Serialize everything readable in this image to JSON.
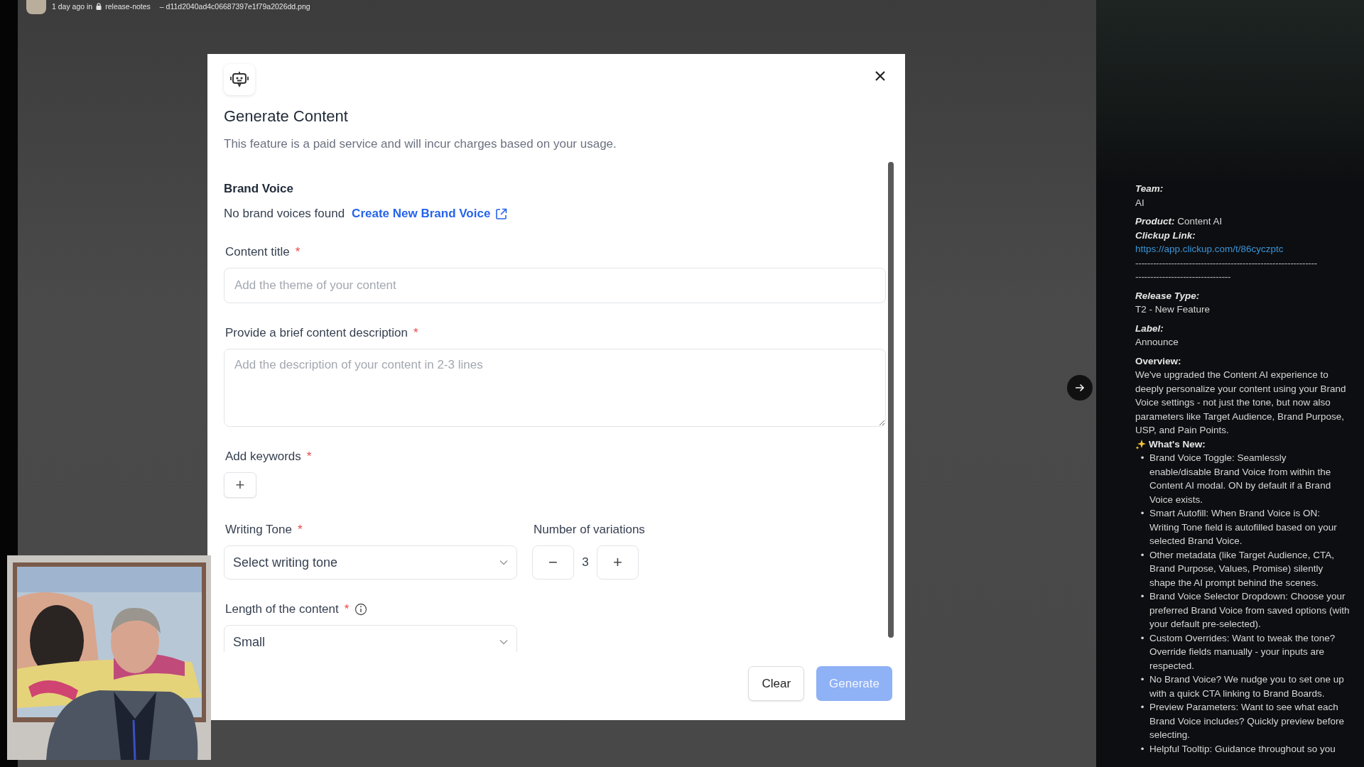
{
  "top_bar": {
    "time": "1 day ago in",
    "channel": "release-notes",
    "file": "– d11d2040ad4c06687397e1f79a2026dd.png"
  },
  "modal": {
    "title": "Generate Content",
    "subtitle": "This feature is a paid service and will incur charges based on your usage.",
    "brand_voice": {
      "heading": "Brand Voice",
      "empty_text": "No brand voices found",
      "link": "Create New Brand Voice"
    },
    "fields": [
      {
        "kind": "text",
        "label": "Content title",
        "required": "*",
        "placeholder": "Add the theme of your content"
      },
      {
        "kind": "textarea",
        "label": "Provide a brief content description",
        "required": "*",
        "placeholder": "Add the description of your content in 2-3 lines"
      },
      {
        "kind": "keywords",
        "label": "Add keywords",
        "required": "*",
        "add": "+"
      }
    ],
    "tone": {
      "label": "Writing Tone",
      "required": "*",
      "placeholder": "Select writing tone"
    },
    "variations": {
      "label": "Number of variations",
      "minus": "−",
      "value": "3",
      "plus": "+"
    },
    "length": {
      "label": "Length of the content",
      "required": "*",
      "info": true,
      "value": "Small"
    },
    "buttons": [
      {
        "label": "Clear",
        "kind": "secondary"
      },
      {
        "label": "Generate",
        "kind": "primary",
        "disabled": true
      }
    ]
  },
  "notes": [
    {
      "lines": [
        {
          "kind": "label",
          "text": "Team:"
        },
        {
          "kind": "text",
          "text": "AI"
        }
      ]
    },
    {
      "lines": [
        {
          "kind": "pair",
          "label": "Product:",
          "text": "Content AI"
        },
        {
          "kind": "label",
          "text": "Clickup Link:"
        },
        {
          "kind": "link",
          "text": "https://app.clickup.com/t/86cyczptc"
        },
        {
          "kind": "rule",
          "text": "-------------------------------------------------------------"
        },
        {
          "kind": "rule",
          "text": "--------------------------------"
        }
      ]
    },
    {
      "lines": [
        {
          "kind": "label",
          "text": "Release Type:"
        },
        {
          "kind": "text",
          "text": "T2 - New Feature"
        }
      ]
    },
    {
      "lines": [
        {
          "kind": "label",
          "text": "Label:"
        },
        {
          "kind": "text",
          "text": "Announce"
        }
      ]
    },
    {
      "lines": [
        {
          "kind": "heading",
          "text": "Overview:"
        },
        {
          "kind": "text",
          "text": "We've upgraded the Content AI experience to deeply personalize your content using your Brand Voice settings - not just the tone, but now also parameters like Target Audience, Brand Purpose, USP, and Pain Points."
        },
        {
          "kind": "sparkle_heading",
          "text": "What's New:"
        },
        {
          "kind": "bullets",
          "marker": "•",
          "items": [
            "Brand Voice Toggle: Seamlessly enable/disable Brand Voice from within the Content AI modal. ON by default if a Brand Voice exists.",
            "Smart Autofill: When Brand Voice is ON: Writing Tone field is autofilled based on your selected Brand Voice.",
            "Other metadata (like Target Audience, CTA, Brand Purpose, Values, Promise) silently shape the AI prompt behind the scenes.",
            "Brand Voice Selector Dropdown: Choose your preferred Brand Voice from saved options (with your default pre-selected).",
            "Custom Overrides: Want to tweak the tone? Override fields manually - your inputs are respected.",
            "No Brand Voice? We nudge you to set one up with a quick CTA linking to Brand Boards.",
            "Preview Parameters: Want to see what each Brand Voice includes? Quickly preview before selecting.",
            "Helpful Tooltip: Guidance throughout so you"
          ]
        }
      ]
    }
  ]
}
